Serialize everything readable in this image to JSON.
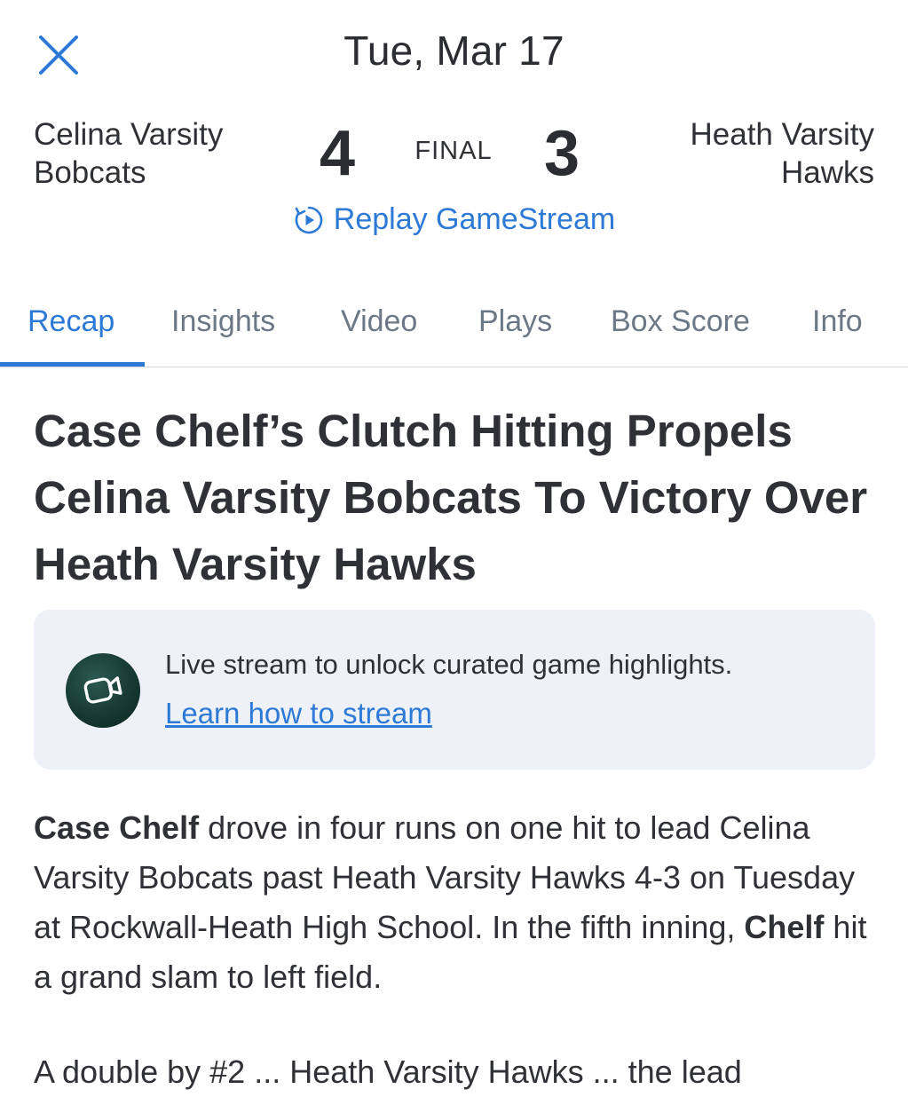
{
  "header": {
    "date": "Tue, Mar 17",
    "close_icon": "close-icon"
  },
  "scoreboard": {
    "home_team_line1": "Celina Varsity",
    "home_team_line2": "Bobcats",
    "home_score": "4",
    "status": "FINAL",
    "away_score": "3",
    "away_team_line1": "Heath Varsity",
    "away_team_line2": "Hawks"
  },
  "replay": {
    "label": "Replay GameStream",
    "icon": "replay-icon"
  },
  "tabs": [
    {
      "label": "Recap",
      "active": true
    },
    {
      "label": "Insights"
    },
    {
      "label": "Video"
    },
    {
      "label": "Plays"
    },
    {
      "label": "Box Score"
    },
    {
      "label": "Info"
    }
  ],
  "article": {
    "headline": "Case Chelf’s Clutch Hitting Propels Celina Varsity Bobcats To Victory Over Heath Varsity Hawks",
    "p1_bold1": "Case Chelf",
    "p1_text1": " drove in four runs on one hit to lead Celina Varsity Bobcats past Heath Varsity Hawks 4-3 on Tuesday at Rockwall-Heath High School. In the fifth inning, ",
    "p1_bold2": "Chelf",
    "p1_text2": " hit a grand slam to left field.",
    "p2_partial": "A double by #2 ... Heath Varsity Hawks ... the lead"
  },
  "promo": {
    "text": "Live stream to unlock curated game highlights.",
    "link": "Learn how to stream",
    "icon": "video-camera-icon"
  },
  "colors": {
    "accent": "#2d7ad6",
    "text": "#2f3136",
    "muted": "#6d7887",
    "promo_bg": "#eef2f8"
  }
}
